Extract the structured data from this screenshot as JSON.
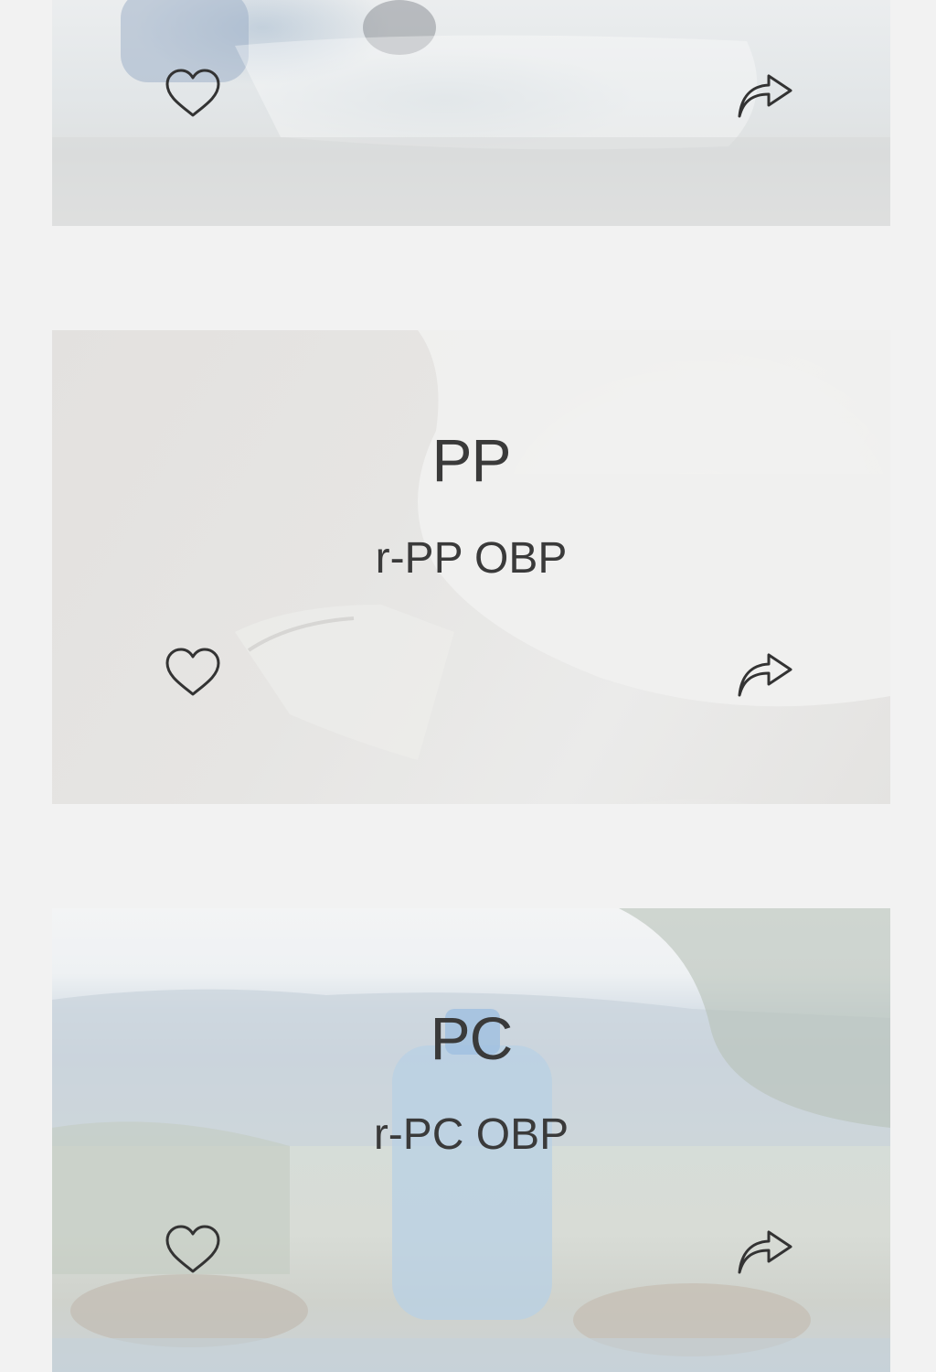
{
  "cards": [
    {
      "name": "",
      "subtitle": "",
      "like_icon": "heart-outline-icon",
      "share_icon": "share-arrow-icon"
    },
    {
      "name": "PP",
      "subtitle": "r-PP OBP",
      "like_icon": "heart-outline-icon",
      "share_icon": "share-arrow-icon"
    },
    {
      "name": "PC",
      "subtitle": "r-PC OBP",
      "like_icon": "heart-outline-icon",
      "share_icon": "share-arrow-icon"
    }
  ],
  "colors": {
    "page_background": "#f2f2f2",
    "text": "#3a3a3a",
    "icon_stroke": "#333333"
  }
}
